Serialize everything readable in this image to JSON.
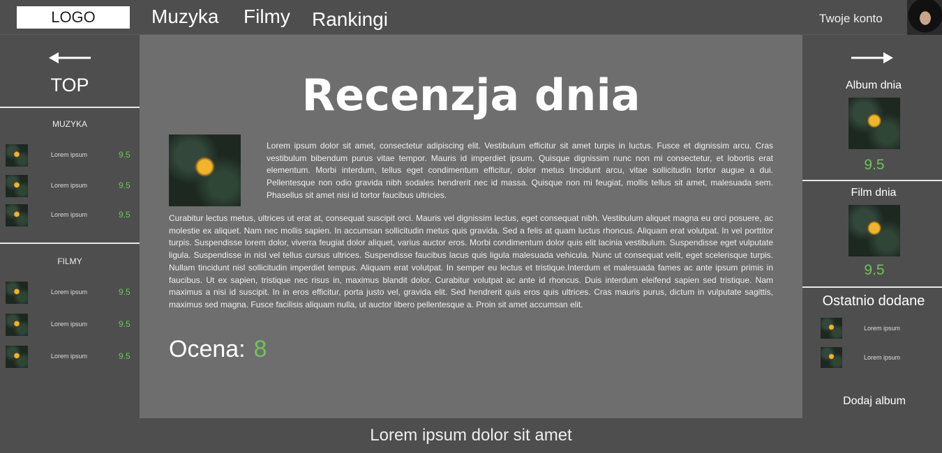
{
  "header": {
    "logo": "LOGO",
    "nav": [
      "Muzyka",
      "Filmy",
      "Rankingi"
    ],
    "account": "Twoje konto"
  },
  "left": {
    "top_label": "TOP",
    "music_title": "MUZYKA",
    "music_items": [
      {
        "name": "Lorem ipsum",
        "score": "9.5"
      },
      {
        "name": "Lorem ipsum",
        "score": "9.5"
      },
      {
        "name": "Lorem ipsum",
        "score": "9.5"
      }
    ],
    "films_title": "FILMY",
    "film_items": [
      {
        "name": "Lorem ipsum",
        "score": "9.5"
      },
      {
        "name": "Lorem ipsum",
        "score": "9.5"
      },
      {
        "name": "Lorem ipsum",
        "score": "9.5"
      }
    ]
  },
  "main": {
    "title": "Recenzja dnia",
    "para1": "Lorem ipsum dolor sit amet, consectetur adipiscing elit. Vestibulum efficitur sit amet turpis in luctus. Fusce et dignissim arcu. Cras vestibulum bibendum purus vitae tempor. Mauris id imperdiet ipsum. Quisque dignissim nunc non mi consectetur, et lobortis erat elementum. Morbi interdum, tellus eget condimentum efficitur, dolor metus tincidunt arcu, vitae sollicitudin tortor augue a dui. Pellentesque non odio gravida nibh sodales hendrerit nec id massa. Quisque non mi feugiat, mollis tellus sit amet, malesuada sem. Phasellus sit amet nisi id tortor faucibus ultricies.",
    "para2": "Curabitur lectus metus, ultrices ut erat at, consequat suscipit orci. Mauris vel dignissim lectus, eget consequat nibh. Vestibulum aliquet magna eu orci posuere, ac molestie ex aliquet. Nam nec mollis sapien. In accumsan sollicitudin metus quis gravida. Sed a felis at quam luctus rhoncus. Aliquam erat volutpat. In vel porttitor turpis. Suspendisse lorem dolor, viverra feugiat dolor aliquet, varius auctor eros. Morbi condimentum dolor quis elit lacinia vestibulum. Suspendisse eget vulputate ligula. Suspendisse in nisl vel tellus cursus ultrices. Suspendisse faucibus lacus quis ligula malesuada vehicula. Nunc ut consequat velit, eget scelerisque turpis. Nullam tincidunt nisl sollicitudin imperdiet tempus. Aliquam erat volutpat. In semper eu lectus et tristique.Interdum et malesuada fames ac ante ipsum primis in faucibus. Ut ex sapien, tristique nec risus in, maximus blandit dolor. Curabitur volutpat ac ante id rhoncus. Duis interdum eleifend sapien sed tristique. Nam maximus a nisi id suscipit. In in eros efficitur, porta justo vel, gravida elit. Sed hendrerit quis eros quis ultrices. Cras mauris purus, dictum in vulputate sagittis, maximus sed magna. Fusce facilisis aliquam nulla, ut auctor libero pellentesque a. Proin sit amet accumsan elit.",
    "rating_label": "Ocena:",
    "rating_value": "8"
  },
  "right": {
    "album_title": "Album dnia",
    "album_score": "9.5",
    "film_title": "Film dnia",
    "film_score": "9.5",
    "recent_title": "Ostatnio dodane",
    "recent_items": [
      {
        "name": "Lorem ipsum"
      },
      {
        "name": "Lorem ipsum"
      }
    ],
    "add_album": "Dodaj album"
  },
  "footer": {
    "text": "Lorem ipsum dolor sit amet"
  },
  "colors": {
    "accent_green": "#6fc35a",
    "background": "#4e4e4e",
    "main_panel": "#6e6e6e"
  }
}
